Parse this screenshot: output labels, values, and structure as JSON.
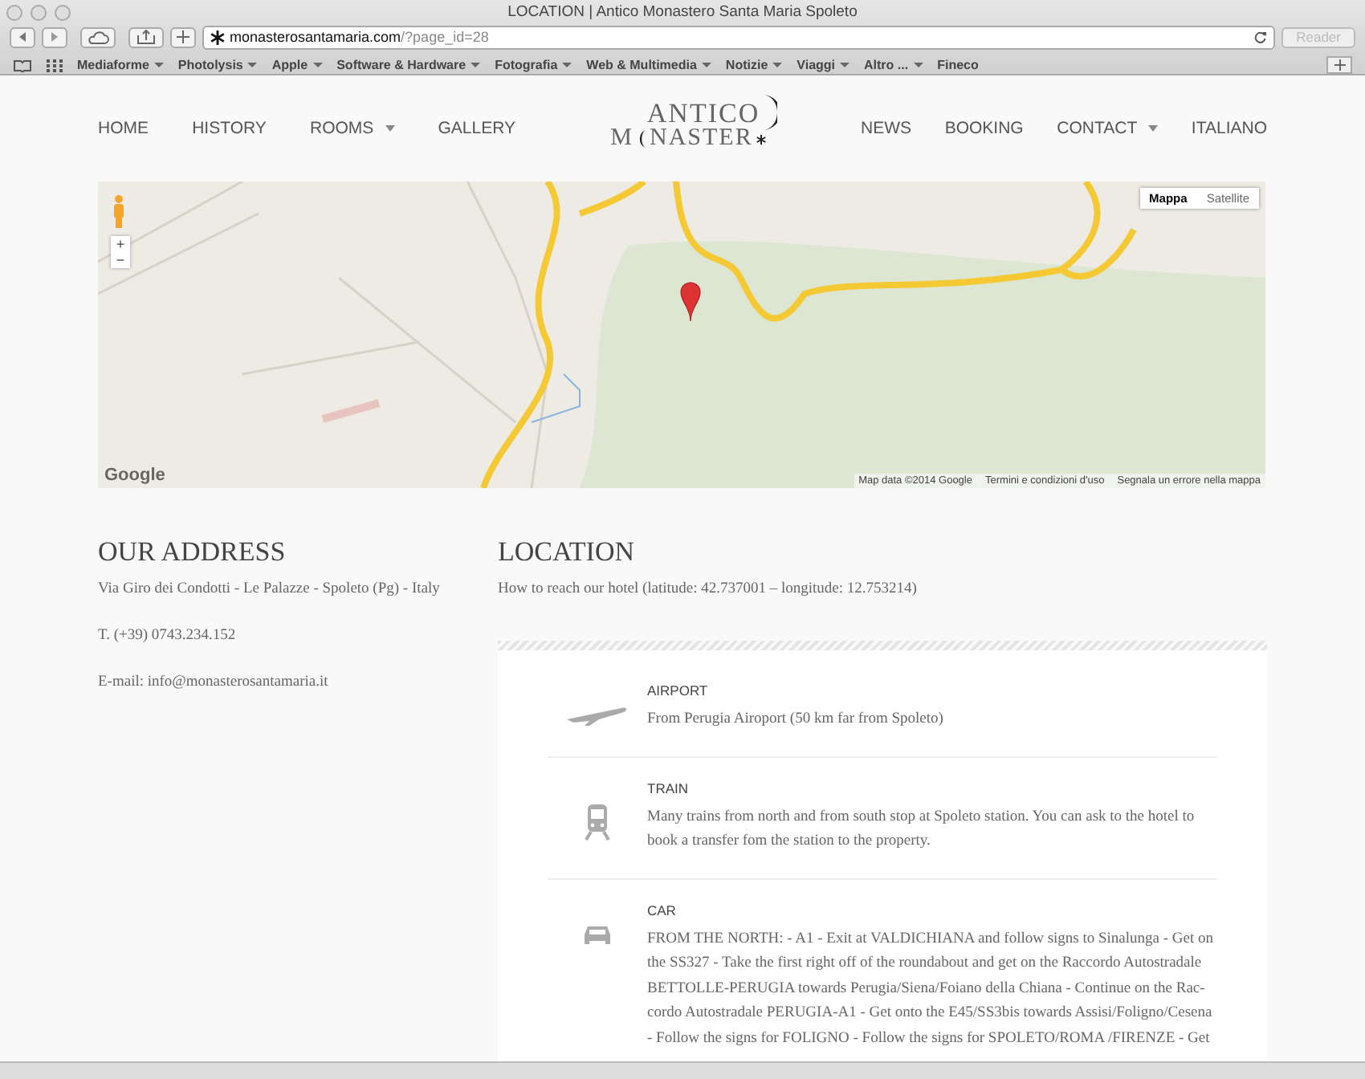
{
  "browser": {
    "title": "LOCATION | Antico Monastero Santa Maria Spoleto",
    "url_domain": "monasterosantamaria.com",
    "url_path": "/?page_id=28",
    "reader": "Reader",
    "bookmarks": [
      {
        "label": "Mediaforme",
        "menu": true
      },
      {
        "label": "Photolysis",
        "menu": true
      },
      {
        "label": "Apple",
        "menu": true
      },
      {
        "label": "Software & Hardware",
        "menu": true
      },
      {
        "label": "Fotografia",
        "menu": true
      },
      {
        "label": "Web & Multimedia",
        "menu": true
      },
      {
        "label": "Notizie",
        "menu": true
      },
      {
        "label": "Viaggi",
        "menu": true
      },
      {
        "label": "Altro ...",
        "menu": true
      },
      {
        "label": "Fineco",
        "menu": false
      }
    ]
  },
  "nav_left": [
    {
      "label": "HOME",
      "dropdown": false
    },
    {
      "label": "HISTORY",
      "dropdown": false
    },
    {
      "label": "ROOMS",
      "dropdown": true
    },
    {
      "label": "GALLERY",
      "dropdown": false
    }
  ],
  "logo": {
    "top": "ANTICO",
    "bottom_start": "M",
    "bottom_end": "NASTER"
  },
  "nav_right": [
    {
      "label": "NEWS",
      "dropdown": false
    },
    {
      "label": "BOOKING",
      "dropdown": false
    },
    {
      "label": "CONTACT",
      "dropdown": true
    },
    {
      "label": "ITALIANO",
      "dropdown": false
    }
  ],
  "map": {
    "types": [
      {
        "label": "Mappa",
        "selected": true
      },
      {
        "label": "Satellite",
        "selected": false
      }
    ],
    "zoom_in": "+",
    "zoom_out": "−",
    "brand": "Google",
    "attribution": [
      "Map data ©2014 Google",
      "Termini e condizioni d'uso",
      "Segnala un errore nella mappa"
    ]
  },
  "address": {
    "title": "OUR ADDRESS",
    "lines": [
      "Via Giro dei Condotti - Le Palazze - Spoleto (Pg) - Italy",
      "T. (+39) 0743.234.152",
      "E-mail: info@monasterosantamaria.it"
    ]
  },
  "location": {
    "title": "LOCATION",
    "intro": "How to reach our hotel (latitude: 42.737001 – longitude: 12.753214)",
    "ways": [
      {
        "kind": "plane",
        "title": "AIRPORT",
        "text": "From Perugia Airoport (50 km far from Spoleto)"
      },
      {
        "kind": "train",
        "title": "TRAIN",
        "text": "Many trains from north and from south stop at Spoleto station. You can ask to the hotel to book a transfer fom the station to the property."
      },
      {
        "kind": "car",
        "title": "CAR",
        "text": "FROM THE NORTH: - A1 - Exit at VALDICHIANA and follow signs to Sinalunga - Get on the SS327 - Take the first right off of the roundabout and get on the Raccordo Autostradale BETTOLLE-PERUGIA towards Perugia/Siena/Foiano della Chiana - Continue on the Rac-cordo Autostradale PERUGIA-A1 - Get onto the E45/SS3bis towards Assisi/Foligno/Cesena - Follow the signs for FOLIGNO - Follow the signs for SPOLETO/ROMA /FIRENZE - Get"
      }
    ]
  }
}
